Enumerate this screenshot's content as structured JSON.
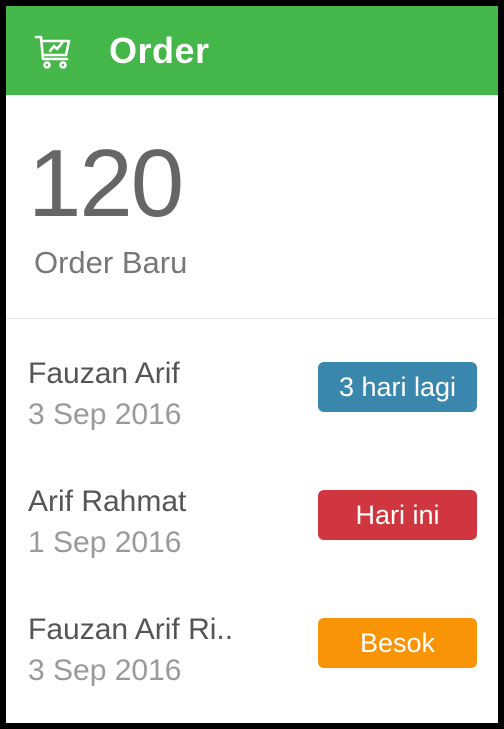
{
  "header": {
    "title": "Order",
    "icon": "shopping-cart-icon",
    "color": "#45b649"
  },
  "summary": {
    "count": "120",
    "label": "Order Baru"
  },
  "orders": [
    {
      "name": "Fauzan Arif",
      "date": "3 Sep 2016",
      "badge": "3 hari lagi",
      "badge_color": "#3a87ad"
    },
    {
      "name": "Arif Rahmat",
      "date": "1 Sep 2016",
      "badge": "Hari ini",
      "badge_color": "#d0363f"
    },
    {
      "name": "Fauzan Arif Ri..",
      "date": "3 Sep 2016",
      "badge": "Besok",
      "badge_color": "#f89406"
    }
  ]
}
